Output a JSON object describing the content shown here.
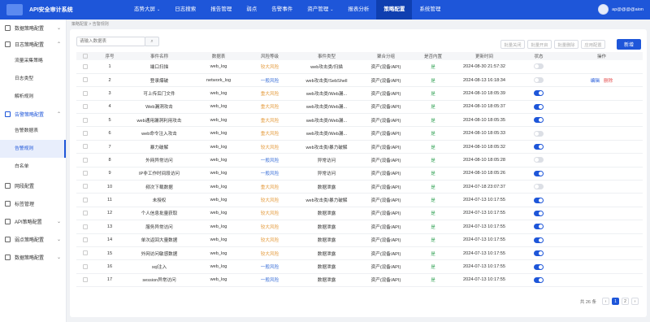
{
  "app": {
    "brand": "API安全审计系统",
    "user": "ap@@@@aion"
  },
  "nav": [
    {
      "label": "态势大屏",
      "caret": "⌄",
      "active": false
    },
    {
      "label": "日志搜索",
      "caret": "",
      "active": false
    },
    {
      "label": "报告管理",
      "caret": "",
      "active": false
    },
    {
      "label": "弱点",
      "caret": "",
      "active": false
    },
    {
      "label": "告警事件",
      "caret": "",
      "active": false
    },
    {
      "label": "资产管理",
      "caret": "⌄",
      "active": false
    },
    {
      "label": "报表分析",
      "caret": "",
      "active": false
    },
    {
      "label": "策略配置",
      "caret": "",
      "active": true
    },
    {
      "label": "系统管理",
      "caret": "",
      "active": false
    }
  ],
  "sidebar": {
    "g1": "数据策略配置",
    "g2": "日志策略配置",
    "g2_items": [
      "流量采集策略",
      "日志类型",
      "解析规则"
    ],
    "g3": "告警策略配置",
    "g3_items": [
      "告警数据表",
      "告警规则",
      "白名单"
    ],
    "g4": "网段配置",
    "g5": "标签管理",
    "g6": "API策略配置",
    "g7": "弱点策略配置",
    "g8": "数据策略配置"
  },
  "breadcrumb": "策略配置  >  告警规则",
  "toolbar": {
    "search_placeholder": "请输入数据表",
    "search_icon": "⌕",
    "batch_close": "批量关闭",
    "batch_open": "批量开启",
    "batch_delete": "批量删除",
    "apply": "应用配置",
    "add": "新增"
  },
  "table": {
    "headers": [
      "序号",
      "事件名称",
      "数据表",
      "风险等级",
      "事件类型",
      "聚合分组",
      "是否内置",
      "更新时间",
      "状态",
      "操作"
    ],
    "rows": [
      {
        "no": "1",
        "name": "端口扫描",
        "table": "web_log",
        "risk": "较大风险",
        "level": "high",
        "type": "web攻击类/扫描",
        "group": "资产(设备/API)",
        "builtin": "是",
        "time": "2024-08-30 21:57:32",
        "on": false,
        "edit": "",
        "del": ""
      },
      {
        "no": "2",
        "name": "登录爆破",
        "table": "network_log",
        "risk": "一般风险",
        "level": "low",
        "type": "web攻击类/SebShell",
        "group": "资产(设备/API)",
        "builtin": "是",
        "time": "2024-08-13 16:18:34",
        "on": false,
        "edit": "编辑",
        "del": "删除"
      },
      {
        "no": "3",
        "name": "可上传后门文件",
        "table": "web_log",
        "risk": "重大风险",
        "level": "high",
        "type": "web攻击类/Web漏...",
        "group": "资产(设备/API)",
        "builtin": "是",
        "time": "2024-08-10 18:05:39",
        "on": true,
        "edit": "",
        "del": ""
      },
      {
        "no": "4",
        "name": "Web漏洞攻击",
        "table": "web_log",
        "risk": "重大风险",
        "level": "high",
        "type": "web攻击类/Web漏...",
        "group": "资产(设备/API)",
        "builtin": "是",
        "time": "2024-08-10 18:05:37",
        "on": true,
        "edit": "",
        "del": ""
      },
      {
        "no": "5",
        "name": "web通用漏洞利用攻击",
        "table": "web_log",
        "risk": "重大风险",
        "level": "high",
        "type": "web攻击类/Web漏...",
        "group": "资产(设备/API)",
        "builtin": "是",
        "time": "2024-08-10 18:05:35",
        "on": true,
        "edit": "",
        "del": ""
      },
      {
        "no": "6",
        "name": "web命令注入攻击",
        "table": "web_log",
        "risk": "重大风险",
        "level": "high",
        "type": "web攻击类/Web漏...",
        "group": "资产(设备/API)",
        "builtin": "是",
        "time": "2024-08-10 18:05:33",
        "on": false,
        "edit": "",
        "del": ""
      },
      {
        "no": "7",
        "name": "暴力破解",
        "table": "web_log",
        "risk": "较大风险",
        "level": "high",
        "type": "web攻击类/暴力破解",
        "group": "资产(设备/API)",
        "builtin": "是",
        "time": "2024-08-10 18:05:32",
        "on": true,
        "edit": "",
        "del": ""
      },
      {
        "no": "8",
        "name": "外网异常访问",
        "table": "web_log",
        "risk": "一般风险",
        "level": "low",
        "type": "异常访问",
        "group": "资产(设备/API)",
        "builtin": "是",
        "time": "2024-08-10 18:05:28",
        "on": false,
        "edit": "",
        "del": ""
      },
      {
        "no": "9",
        "name": "IP非工作时间段访问",
        "table": "web_log",
        "risk": "一般风险",
        "level": "low",
        "type": "异常访问",
        "group": "资产(设备/API)",
        "builtin": "是",
        "time": "2024-08-10 18:05:26",
        "on": true,
        "edit": "",
        "del": ""
      },
      {
        "no": "10",
        "name": "频次下载数据",
        "table": "web_log",
        "risk": "重大风险",
        "level": "high",
        "type": "数据泄露",
        "group": "资产(设备/API)",
        "builtin": "是",
        "time": "2024-07-18 23:07:37",
        "on": false,
        "edit": "",
        "del": ""
      },
      {
        "no": "11",
        "name": "未授权",
        "table": "web_log",
        "risk": "较大风险",
        "level": "high",
        "type": "web攻击类/暴力破解",
        "group": "资产(设备/API)",
        "builtin": "是",
        "time": "2024-07-13 10:17:55",
        "on": true,
        "edit": "",
        "del": ""
      },
      {
        "no": "12",
        "name": "个人信息批量获取",
        "table": "web_log",
        "risk": "较大风险",
        "level": "high",
        "type": "数据泄露",
        "group": "资产(设备/API)",
        "builtin": "是",
        "time": "2024-07-13 10:17:55",
        "on": true,
        "edit": "",
        "del": ""
      },
      {
        "no": "13",
        "name": "服务异常访问",
        "table": "web_log",
        "risk": "较大风险",
        "level": "high",
        "type": "数据泄露",
        "group": "资产(设备/API)",
        "builtin": "是",
        "time": "2024-07-13 10:17:55",
        "on": true,
        "edit": "",
        "del": ""
      },
      {
        "no": "14",
        "name": "单次返回大量数据",
        "table": "web_log",
        "risk": "较大风险",
        "level": "high",
        "type": "数据泄露",
        "group": "资产(设备/API)",
        "builtin": "是",
        "time": "2024-07-13 10:17:55",
        "on": true,
        "edit": "",
        "del": ""
      },
      {
        "no": "15",
        "name": "外网访问敏感数据",
        "table": "web_log",
        "risk": "较大风险",
        "level": "high",
        "type": "数据泄露",
        "group": "资产(设备/API)",
        "builtin": "是",
        "time": "2024-07-13 10:17:55",
        "on": true,
        "edit": "",
        "del": ""
      },
      {
        "no": "16",
        "name": "sql注入",
        "table": "web_log",
        "risk": "一般风险",
        "level": "low",
        "type": "数据泄露",
        "group": "资产(设备/API)",
        "builtin": "是",
        "time": "2024-07-13 10:17:55",
        "on": true,
        "edit": "",
        "del": ""
      },
      {
        "no": "17",
        "name": "session异常访问",
        "table": "web_log",
        "risk": "一般风险",
        "level": "low",
        "type": "数据泄露",
        "group": "资产(设备/API)",
        "builtin": "是",
        "time": "2024-07-13 10:17:55",
        "on": true,
        "edit": "",
        "del": ""
      }
    ]
  },
  "pager": {
    "total": "共 26 条",
    "prev": "‹",
    "pages": [
      "1",
      "2"
    ],
    "next": "›"
  }
}
